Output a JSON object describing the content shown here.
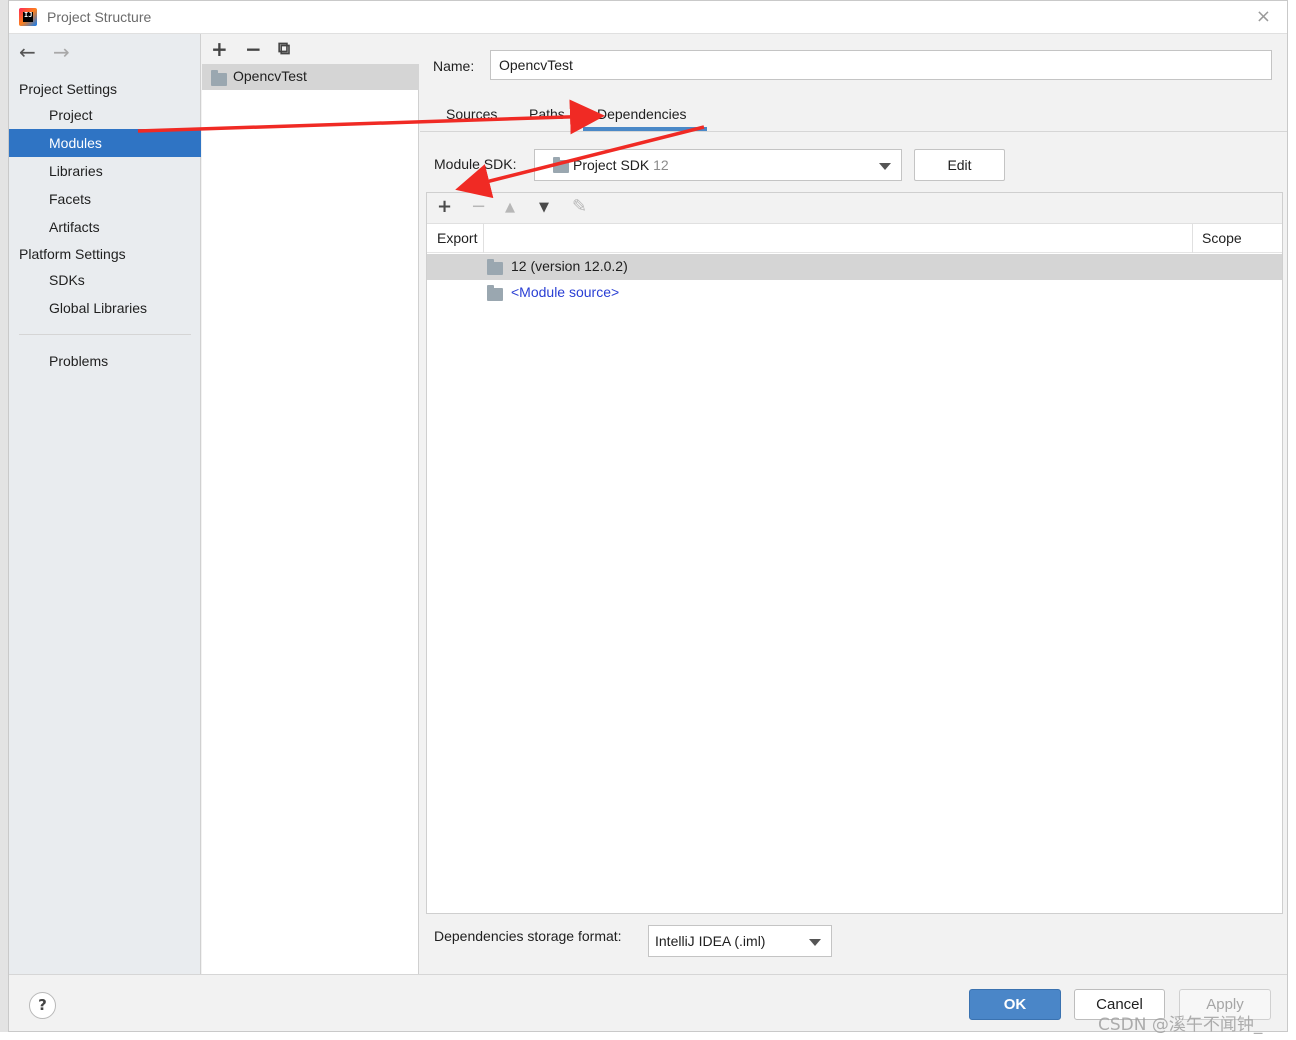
{
  "window": {
    "title": "Project Structure",
    "close_icon": "×"
  },
  "nav": {
    "back_icon": "←",
    "forward_icon": "→",
    "sections": {
      "project_settings": "Project Settings",
      "platform_settings": "Platform Settings"
    },
    "items": [
      {
        "label": "Project",
        "selected": false
      },
      {
        "label": "Modules",
        "selected": true
      },
      {
        "label": "Libraries",
        "selected": false
      },
      {
        "label": "Facets",
        "selected": false
      },
      {
        "label": "Artifacts",
        "selected": false
      },
      {
        "label": "SDKs",
        "selected": false
      },
      {
        "label": "Global Libraries",
        "selected": false
      },
      {
        "label": "Problems",
        "selected": false
      }
    ]
  },
  "modules": {
    "toolbar": {
      "add": "+",
      "remove": "−",
      "copy": "⧉"
    },
    "list": [
      {
        "name": "OpencvTest"
      }
    ]
  },
  "module": {
    "name_label": "Name:",
    "name_value": "OpencvTest",
    "tabs": [
      "Sources",
      "Paths",
      "Dependencies"
    ],
    "active_tab": "Dependencies",
    "sdk_label": "Module SDK:",
    "sdk_value": "Project SDK",
    "sdk_version": "12",
    "edit_label": "Edit",
    "dep_toolbar": {
      "add": "+",
      "remove": "−",
      "up": "▲",
      "down": "▼",
      "edit": "✎"
    },
    "columns": {
      "export": "Export",
      "scope": "Scope"
    },
    "dependencies": [
      {
        "label": "12 (version 12.0.2)",
        "selected": true,
        "link": false
      },
      {
        "label": "<Module source>",
        "selected": false,
        "link": true
      }
    ],
    "storage_label": "Dependencies storage format:",
    "storage_value": "IntelliJ IDEA (.iml)"
  },
  "footer": {
    "help": "?",
    "ok": "OK",
    "cancel": "Cancel",
    "apply": "Apply"
  },
  "watermark": "CSDN @溪午不闻钟_",
  "colors": {
    "selection": "#2f74c4",
    "primary_button": "#4a86c8",
    "annotation_arrow": "#f02a24",
    "link": "#2a3fd4"
  }
}
